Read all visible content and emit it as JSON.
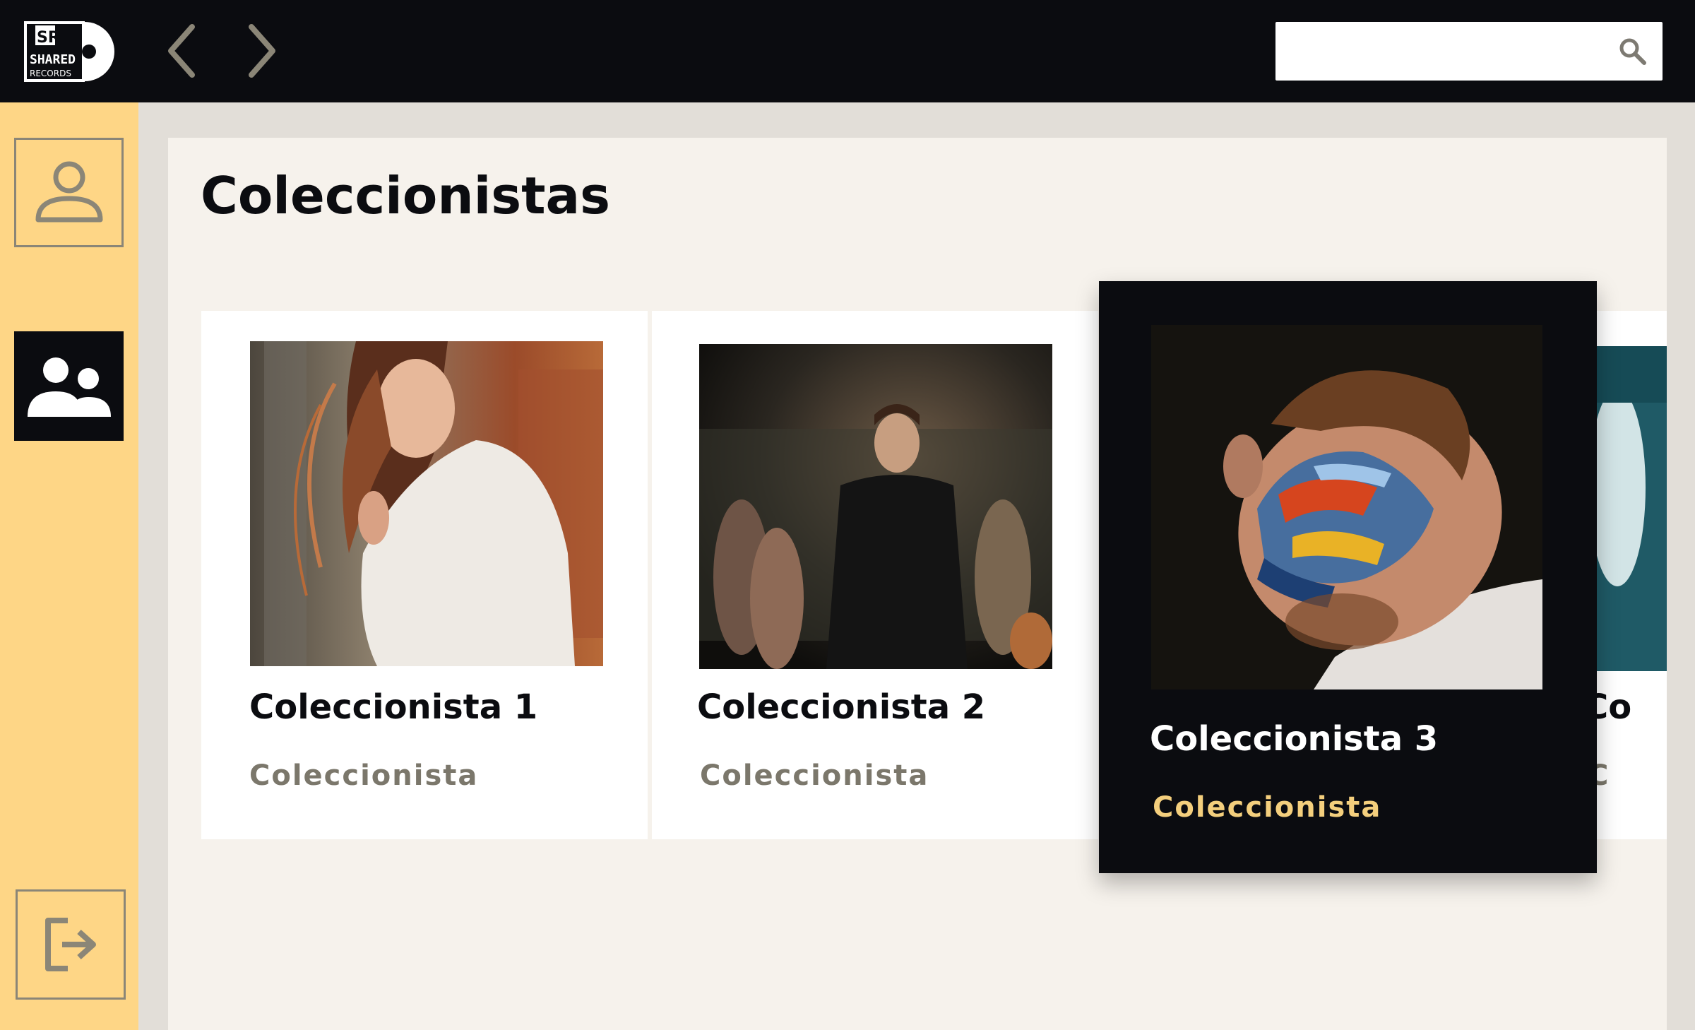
{
  "app": {
    "logo_text_top": "SR",
    "logo_text_mid": "SHARED",
    "logo_text_bottom": "RECORDS"
  },
  "topbar": {
    "back_icon": "chevron-left-icon",
    "forward_icon": "chevron-right-icon",
    "search": {
      "value": "",
      "placeholder": "",
      "icon": "search-icon"
    }
  },
  "sidebar": {
    "items": [
      {
        "icon": "user-icon",
        "active": false
      },
      {
        "icon": "users-icon",
        "active": true
      },
      {
        "icon": "logout-icon",
        "active": false
      }
    ]
  },
  "main": {
    "title": "Coleccionistas",
    "cards": [
      {
        "name": "Coleccionista 1",
        "role": "Coleccionista",
        "selected": false
      },
      {
        "name": "Coleccionista 2",
        "role": "Coleccionista",
        "selected": false
      },
      {
        "name": "Coleccionista 3",
        "role": "Coleccionista",
        "selected": true
      },
      {
        "name": "Co",
        "role": "C",
        "selected": false
      }
    ]
  },
  "colors": {
    "topbar": "#0b0c10",
    "sidebar": "#fed686",
    "panel": "#f6f2ec",
    "selected_card": "#0b0c10",
    "selected_role": "#f4cf7d",
    "muted_role": "#7b776b"
  }
}
